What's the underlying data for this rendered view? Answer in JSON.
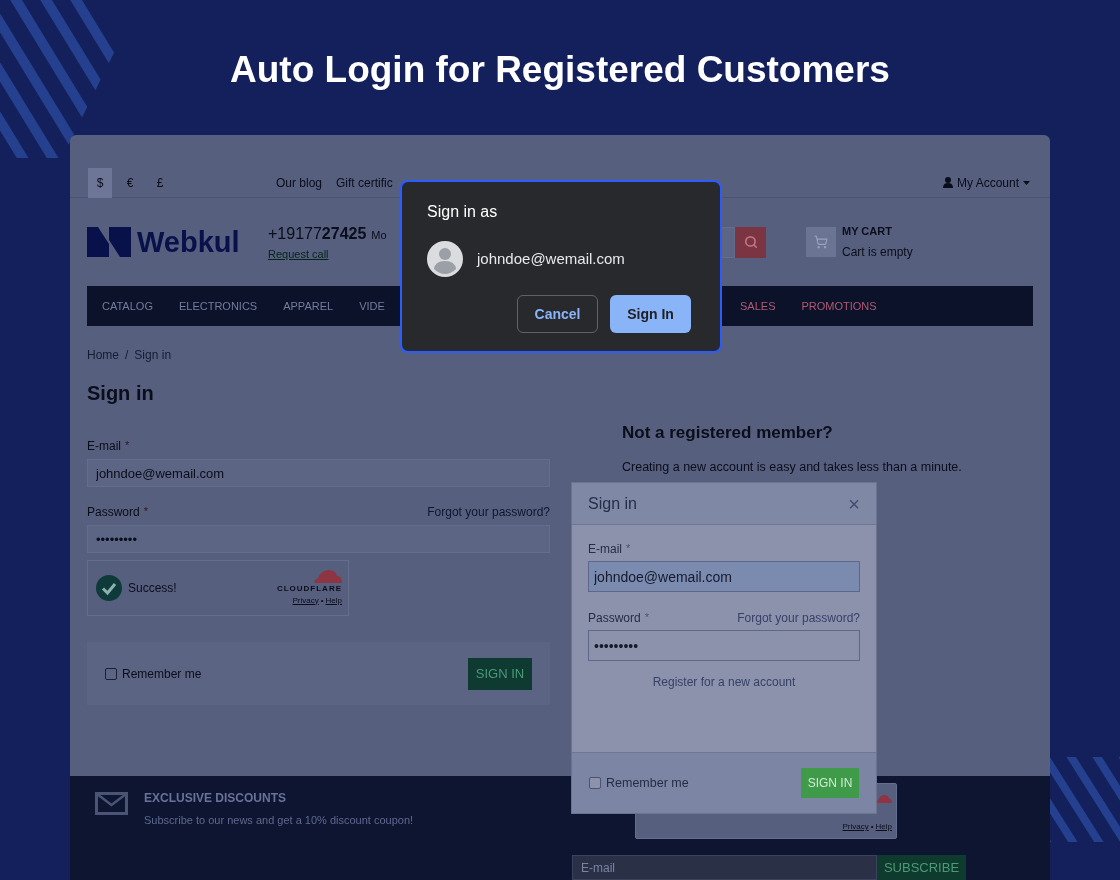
{
  "banner": {
    "title": "Auto Login for Registered Customers"
  },
  "store": {
    "top_bar": {
      "currencies": [
        {
          "symbol": "$",
          "selected": true
        },
        {
          "symbol": "€",
          "selected": false
        },
        {
          "symbol": "£",
          "selected": false
        }
      ],
      "links": [
        "Our blog",
        "Gift certific"
      ],
      "account": "My Account"
    },
    "header": {
      "logo": "Webkul",
      "phone": "+19177**27425**",
      "phone_note": "Mo",
      "request_call": "Request call",
      "cart": {
        "title": "MY CART",
        "status": "Cart is empty"
      }
    },
    "nav": [
      {
        "label": "CATALOG",
        "kind": "regular"
      },
      {
        "label": "ELECTRONICS",
        "kind": "regular"
      },
      {
        "label": "APPAREL",
        "kind": "regular"
      },
      {
        "label": "VIDE",
        "kind": "regular"
      },
      {
        "label": "SALES",
        "kind": "promo"
      },
      {
        "label": "PROMOTIONS",
        "kind": "promo"
      }
    ],
    "breadcrumb": {
      "items": [
        "Home",
        "Sign in"
      ],
      "separator": "/"
    },
    "page_title": "Sign in",
    "login_form": {
      "fields": [
        {
          "label": "E-mail",
          "mark": "*",
          "value": "johndoe@wemail.com"
        },
        {
          "label": "Password",
          "mark": "*",
          "link": "Forgot your password?",
          "value": "•••••••••"
        }
      ],
      "captcha": {
        "status": "Success!",
        "brand": "CLOUDFLARE",
        "links": [
          "Privacy",
          "Help"
        ],
        "separator": "•"
      },
      "remember": {
        "label": "Remember me",
        "checked": false
      },
      "submit": "SIGN IN"
    },
    "register": {
      "title": "Not a registered member?",
      "text": "Creating a new account is easy and takes less than a minute."
    },
    "footer": {
      "newsletter": {
        "title": "EXCLUSIVE DISCOUNTS",
        "text": "Subscribe to our news and get a 10% discount coupon!"
      },
      "captcha": {
        "links": [
          "Privacy",
          "Help"
        ],
        "separator": "•"
      },
      "email_placeholder": "E-mail",
      "subscribe": "SUBSCRIBE"
    }
  },
  "login_modal": {
    "title": "Sign in",
    "close": "×",
    "fields": [
      {
        "label": "E-mail",
        "mark": "*",
        "value": "johndoe@wemail.com",
        "highlighted": true
      },
      {
        "label": "Password",
        "mark": "*",
        "link": "Forgot your password?",
        "value": "•••••••••",
        "highlighted": false
      }
    ],
    "register_link": "Register for a new account",
    "remember": {
      "label": "Remember me",
      "checked": false
    },
    "submit": "SIGN IN"
  },
  "account_chooser": {
    "title": "Sign in as",
    "email": "johndoe@wemail.com",
    "buttons": [
      {
        "label": "Cancel",
        "kind": "secondary"
      },
      {
        "label": "Sign In",
        "kind": "primary"
      }
    ]
  }
}
